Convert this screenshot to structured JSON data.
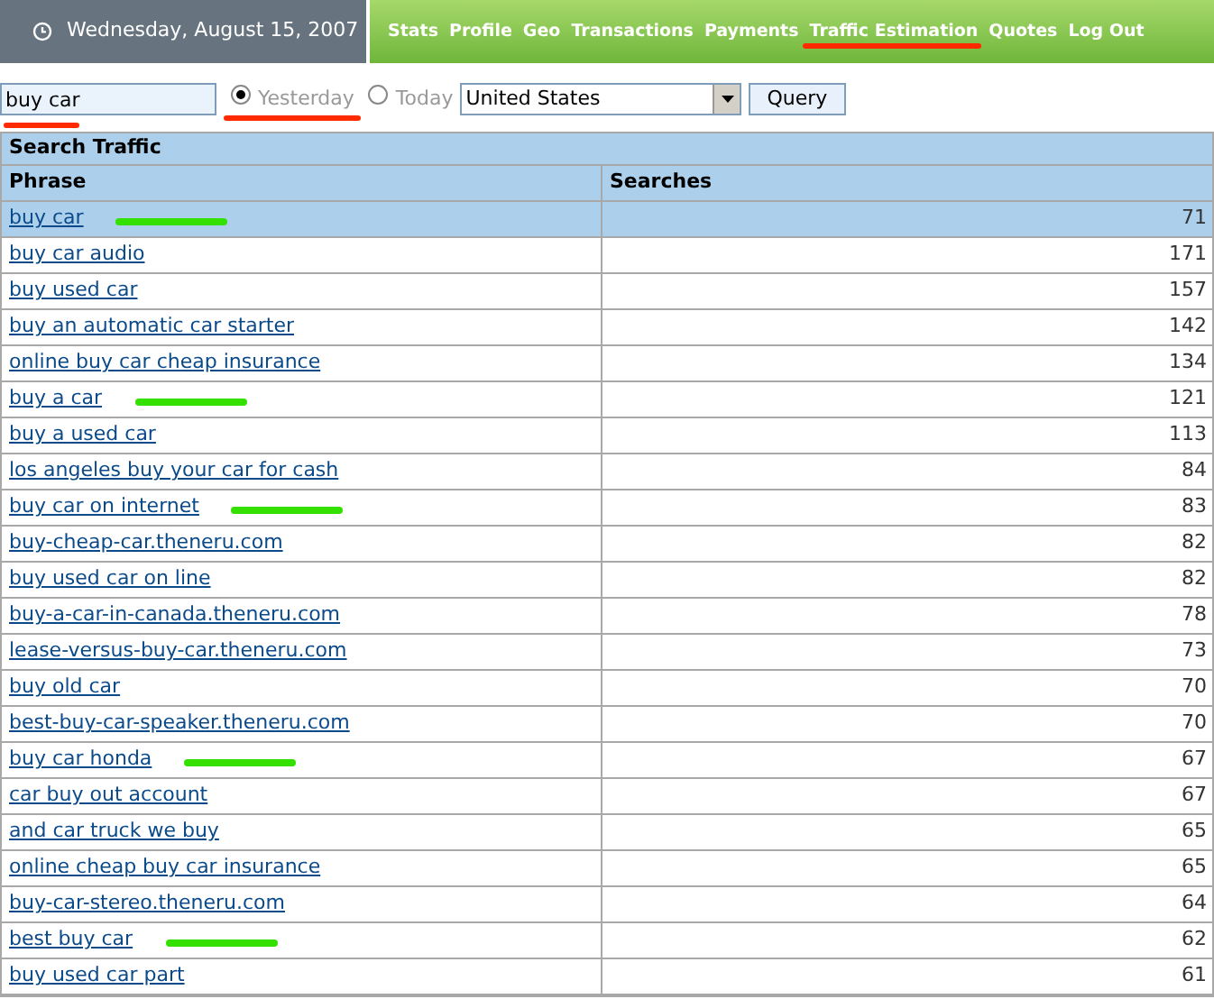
{
  "header": {
    "date": "Wednesday, August 15, 2007"
  },
  "nav": [
    {
      "label": "Stats",
      "marked": false
    },
    {
      "label": "Profile",
      "marked": false
    },
    {
      "label": "Geo",
      "marked": false
    },
    {
      "label": "Transactions",
      "marked": false
    },
    {
      "label": "Payments",
      "marked": false
    },
    {
      "label": "Traffic Estimation",
      "marked": true
    },
    {
      "label": "Quotes",
      "marked": false
    },
    {
      "label": "Log Out",
      "marked": false
    }
  ],
  "query": {
    "value": "buy car",
    "marked": true,
    "periods": [
      {
        "label": "Yesterday",
        "selected": true,
        "marked": true
      },
      {
        "label": "Today",
        "selected": false,
        "marked": false
      }
    ],
    "country": "United States",
    "button": "Query"
  },
  "table": {
    "title": "Search Traffic",
    "columns": [
      "Phrase",
      "Searches"
    ],
    "rows": [
      {
        "phrase": "buy car",
        "searches": "71",
        "selected": true,
        "marked": true
      },
      {
        "phrase": "buy car audio",
        "searches": "171",
        "selected": false,
        "marked": false
      },
      {
        "phrase": "buy used car",
        "searches": "157",
        "selected": false,
        "marked": false
      },
      {
        "phrase": "buy an automatic car starter",
        "searches": "142",
        "selected": false,
        "marked": false
      },
      {
        "phrase": "online buy car cheap insurance",
        "searches": "134",
        "selected": false,
        "marked": false
      },
      {
        "phrase": "buy a car",
        "searches": "121",
        "selected": false,
        "marked": true
      },
      {
        "phrase": "buy a used car",
        "searches": "113",
        "selected": false,
        "marked": false
      },
      {
        "phrase": "los angeles buy your car for cash",
        "searches": "84",
        "selected": false,
        "marked": false
      },
      {
        "phrase": "buy car on internet",
        "searches": "83",
        "selected": false,
        "marked": true
      },
      {
        "phrase": "buy-cheap-car.theneru.com",
        "searches": "82",
        "selected": false,
        "marked": false
      },
      {
        "phrase": "buy used car on line",
        "searches": "82",
        "selected": false,
        "marked": false
      },
      {
        "phrase": "buy-a-car-in-canada.theneru.com",
        "searches": "78",
        "selected": false,
        "marked": false
      },
      {
        "phrase": "lease-versus-buy-car.theneru.com",
        "searches": "73",
        "selected": false,
        "marked": false
      },
      {
        "phrase": "buy old car",
        "searches": "70",
        "selected": false,
        "marked": false
      },
      {
        "phrase": "best-buy-car-speaker.theneru.com",
        "searches": "70",
        "selected": false,
        "marked": false
      },
      {
        "phrase": "buy car honda",
        "searches": "67",
        "selected": false,
        "marked": true
      },
      {
        "phrase": "car buy out account",
        "searches": "67",
        "selected": false,
        "marked": false
      },
      {
        "phrase": "and car truck we buy",
        "searches": "65",
        "selected": false,
        "marked": false
      },
      {
        "phrase": "online cheap buy car insurance",
        "searches": "65",
        "selected": false,
        "marked": false
      },
      {
        "phrase": "buy-car-stereo.theneru.com",
        "searches": "64",
        "selected": false,
        "marked": false
      },
      {
        "phrase": "best buy car",
        "searches": "62",
        "selected": false,
        "marked": true
      },
      {
        "phrase": "buy used car part",
        "searches": "61",
        "selected": false,
        "marked": false
      }
    ]
  }
}
